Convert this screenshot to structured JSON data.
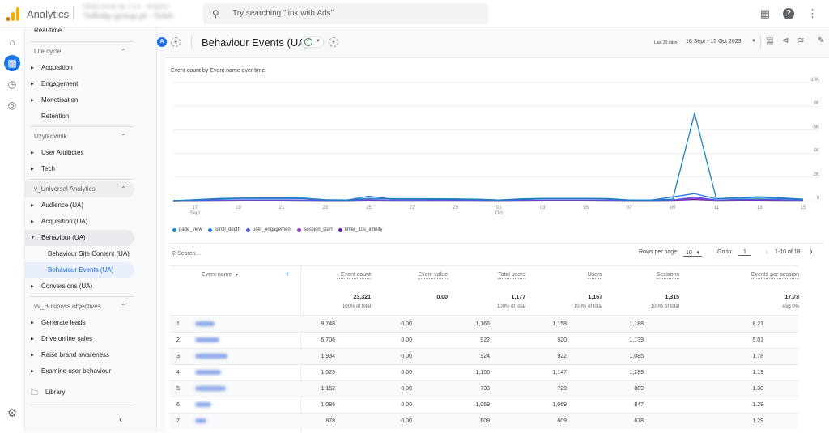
{
  "topbar": {
    "app_title": "Analytics",
    "account_line1": "Infinity Group Sp. z o.o. - Analytics",
    "account_line2": "*infinity-group.pl - GA4-",
    "search_placeholder": "Try searching \"link with Ads\"",
    "icons": [
      "apps-grid-icon",
      "help-icon",
      "more-vert-icon"
    ]
  },
  "rail": {
    "icons": [
      "home-icon",
      "reports-icon",
      "explore-icon",
      "advertising-icon",
      "settings-icon"
    ]
  },
  "nav": {
    "realtime": "Real-time",
    "sections": [
      {
        "label": "Life cycle",
        "items": [
          "Acquisition",
          "Engagement",
          "Monetisation",
          "Retention"
        ]
      },
      {
        "label": "Użytkownik",
        "items": [
          "User Attributes",
          "Tech"
        ]
      },
      {
        "label": "v_Universal Analytics",
        "items": [
          "Audience (UA)",
          "Acquisition (UA)",
          "Behaviour (UA)",
          "Behaviour Site Content (UA)",
          "Behaviour Events (UA)",
          "Conversions (UA)"
        ]
      },
      {
        "label": "vv_Business objectives",
        "items": [
          "Generate leads",
          "Drive online sales",
          "Raise brand awareness",
          "Examine user behaviour"
        ]
      }
    ],
    "library": "Library",
    "collapse_icon": "chevron-left-icon"
  },
  "header": {
    "comparison_avatar": "A",
    "title": "Behaviour Events (UA)",
    "date_label": "Last 30 days",
    "date_range": "16 Sept - 15 Oct 2023"
  },
  "chart_data": {
    "type": "line",
    "title": "Event count by Event name over time",
    "x": [
      "16",
      "17",
      "18",
      "19",
      "20",
      "21",
      "22",
      "23",
      "24",
      "25",
      "26",
      "27",
      "28",
      "29",
      "30",
      "01",
      "02",
      "03",
      "04",
      "05",
      "06",
      "07",
      "08",
      "09",
      "10",
      "11",
      "12",
      "13",
      "14",
      "15"
    ],
    "x_tick_labels": [
      {
        "day": "17",
        "month": "Sept"
      },
      {
        "day": "19"
      },
      {
        "day": "21"
      },
      {
        "day": "23"
      },
      {
        "day": "25"
      },
      {
        "day": "27"
      },
      {
        "day": "29"
      },
      {
        "day": "01",
        "month": "Oct"
      },
      {
        "day": "03"
      },
      {
        "day": "05"
      },
      {
        "day": "07"
      },
      {
        "day": "09"
      },
      {
        "day": "11"
      },
      {
        "day": "13"
      },
      {
        "day": "15"
      }
    ],
    "y_ticks": [
      "0",
      "2K",
      "4K",
      "6K",
      "8K",
      "10K"
    ],
    "ylim": [
      0,
      10000
    ],
    "grid": true,
    "legend_position": "bottom-left",
    "series": [
      {
        "name": "page_view",
        "color": "#1a7fc1",
        "values": [
          0,
          80,
          180,
          220,
          230,
          230,
          220,
          80,
          60,
          200,
          170,
          170,
          160,
          150,
          120,
          60,
          150,
          200,
          200,
          200,
          180,
          60,
          60,
          120,
          7400,
          180,
          200,
          210,
          180,
          120
        ]
      },
      {
        "name": "scroll_depth",
        "color": "#2c78e4",
        "values": [
          0,
          60,
          150,
          190,
          190,
          190,
          180,
          60,
          50,
          380,
          160,
          160,
          150,
          140,
          100,
          50,
          130,
          180,
          180,
          180,
          160,
          50,
          50,
          320,
          600,
          160,
          260,
          330,
          240,
          120
        ]
      },
      {
        "name": "user_engagement",
        "color": "#4f5bd5",
        "values": [
          0,
          40,
          60,
          70,
          70,
          70,
          60,
          30,
          30,
          90,
          60,
          60,
          60,
          55,
          40,
          30,
          60,
          70,
          70,
          70,
          60,
          30,
          30,
          60,
          300,
          60,
          90,
          100,
          80,
          50
        ]
      },
      {
        "name": "session_start",
        "color": "#8f40d4",
        "values": [
          0,
          30,
          50,
          60,
          60,
          60,
          50,
          25,
          25,
          70,
          50,
          50,
          50,
          45,
          35,
          25,
          50,
          60,
          60,
          60,
          50,
          25,
          25,
          50,
          200,
          50,
          70,
          80,
          60,
          40
        ]
      },
      {
        "name": "timer_10s_infinity",
        "color": "#6a1b9a",
        "values": [
          0,
          20,
          30,
          40,
          40,
          40,
          30,
          20,
          20,
          40,
          30,
          30,
          30,
          30,
          25,
          20,
          30,
          40,
          40,
          40,
          30,
          20,
          20,
          30,
          100,
          30,
          40,
          40,
          30,
          25
        ]
      }
    ]
  },
  "table": {
    "search_placeholder": "Search...",
    "rows_per_page_label": "Rows per page:",
    "rows_per_page": "10",
    "goto_label": "Go to:",
    "goto_value": "1",
    "page_range": "1-10 of 18",
    "dimension_header": "Event name",
    "columns": [
      "Event count",
      "Event value",
      "Total users",
      "Users",
      "Sessions",
      "Events per session"
    ],
    "totals": [
      "23,321",
      "0.00",
      "1,177",
      "1,167",
      "1,315",
      "17.73"
    ],
    "totals_sub": [
      "100% of total",
      "",
      "100% of total",
      "100% of total",
      "100% of total",
      "Avg 0%"
    ],
    "rows": [
      {
        "idx": "1",
        "values": [
          "9,748",
          "0.00",
          "1,166",
          "1,158",
          "1,188",
          "8.21"
        ]
      },
      {
        "idx": "2",
        "values": [
          "5,706",
          "0.00",
          "922",
          "920",
          "1,139",
          "5.01"
        ]
      },
      {
        "idx": "3",
        "values": [
          "1,934",
          "0.00",
          "924",
          "922",
          "1,085",
          "1.78"
        ]
      },
      {
        "idx": "4",
        "values": [
          "1,529",
          "0.00",
          "1,156",
          "1,147",
          "1,289",
          "1.19"
        ]
      },
      {
        "idx": "5",
        "values": [
          "1,152",
          "0.00",
          "733",
          "729",
          "889",
          "1.30"
        ]
      },
      {
        "idx": "6",
        "values": [
          "1,086",
          "0.00",
          "1,069",
          "1,069",
          "847",
          "1.28"
        ]
      },
      {
        "idx": "7",
        "values": [
          "878",
          "0.00",
          "609",
          "609",
          "678",
          "1.29"
        ]
      }
    ]
  }
}
